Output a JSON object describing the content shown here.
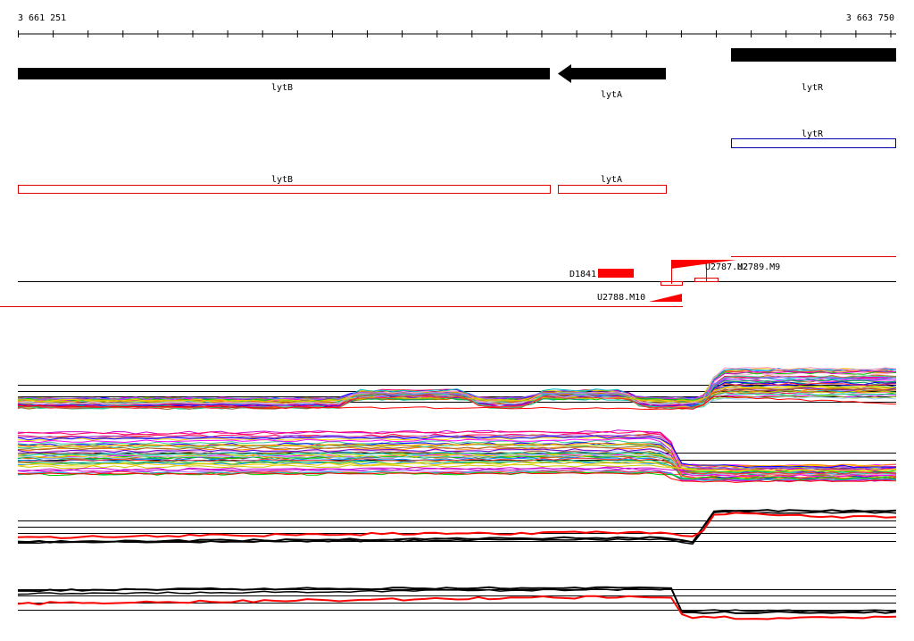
{
  "ruler": {
    "start_label": "3 661 251",
    "end_label": "3 663 750"
  },
  "colors": {
    "gene_fill": "#000000",
    "cds_red": "#e00000",
    "cds_blue": "#0000aa",
    "trace_red": "#ff0000",
    "guide": "#000000",
    "background": "#ffffff"
  },
  "genes": [
    {
      "name": "lytB",
      "strand": "-"
    },
    {
      "name": "lytA",
      "strand": "-"
    },
    {
      "name": "lytR",
      "strand": "+"
    }
  ],
  "cds_blue": [
    {
      "name": "lytR"
    }
  ],
  "cds_red": [
    {
      "name": "lytB"
    },
    {
      "name": "lytA"
    }
  ],
  "features": [
    {
      "name": "D1841"
    },
    {
      "name": "U2787.M2"
    },
    {
      "name": "U2789.M9"
    },
    {
      "name": "U2788.M10"
    }
  ]
}
